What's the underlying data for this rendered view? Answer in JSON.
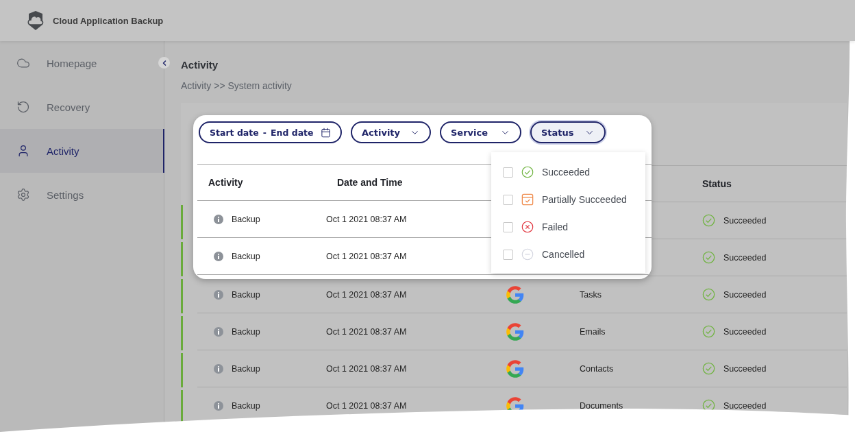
{
  "app": {
    "title": "Cloud Application Backup"
  },
  "sidebar": {
    "items": [
      {
        "label": "Homepage",
        "selected": false
      },
      {
        "label": "Recovery",
        "selected": false
      },
      {
        "label": "Activity",
        "selected": true
      },
      {
        "label": "Settings",
        "selected": false
      }
    ]
  },
  "page": {
    "title": "Activity",
    "breadcrumb": "Activity >> System activity"
  },
  "filters": [
    {
      "kind": "date",
      "start": "Start date",
      "separator": "-",
      "end": "End date",
      "expanded": false
    },
    {
      "kind": "select",
      "label": "Activity",
      "expanded": false
    },
    {
      "kind": "select",
      "label": "Service",
      "expanded": false
    },
    {
      "kind": "select",
      "label": "Status",
      "expanded": true
    }
  ],
  "status_menu": {
    "options": [
      {
        "label": "Succeeded",
        "kind": "succeeded",
        "checked": false
      },
      {
        "label": "Partially Succeeded",
        "kind": "partial",
        "checked": false
      },
      {
        "label": "Failed",
        "kind": "failed",
        "checked": false
      },
      {
        "label": "Cancelled",
        "kind": "cancelled",
        "checked": false
      }
    ]
  },
  "table": {
    "columns": [
      "Activity",
      "Date and Time",
      "Status"
    ],
    "rows": [
      {
        "activity": "Backup",
        "datetime": "Oct 1 2021 08:37 AM",
        "status": {
          "label": "Succeeded",
          "kind": "succeeded"
        }
      },
      {
        "activity": "Backup",
        "datetime": "Oct 1 2021 08:37 AM",
        "status": {
          "label": "Succeeded",
          "kind": "succeeded"
        }
      },
      {
        "activity": "Backup",
        "datetime": "Oct 1 2021 08:37 AM",
        "name": "Tasks",
        "status": {
          "label": "Succeeded",
          "kind": "succeeded"
        }
      },
      {
        "activity": "Backup",
        "datetime": "Oct 1 2021 08:37 AM",
        "name": "Emails",
        "status": {
          "label": "Succeeded",
          "kind": "succeeded"
        }
      },
      {
        "activity": "Backup",
        "datetime": "Oct 1 2021 08:37 AM",
        "name": "Contacts",
        "status": {
          "label": "Succeeded",
          "kind": "succeeded"
        }
      },
      {
        "activity": "Backup",
        "datetime": "Oct 1 2021 08:37 AM",
        "name": "Documents",
        "status": {
          "label": "Succeeded",
          "kind": "succeeded"
        }
      }
    ]
  }
}
